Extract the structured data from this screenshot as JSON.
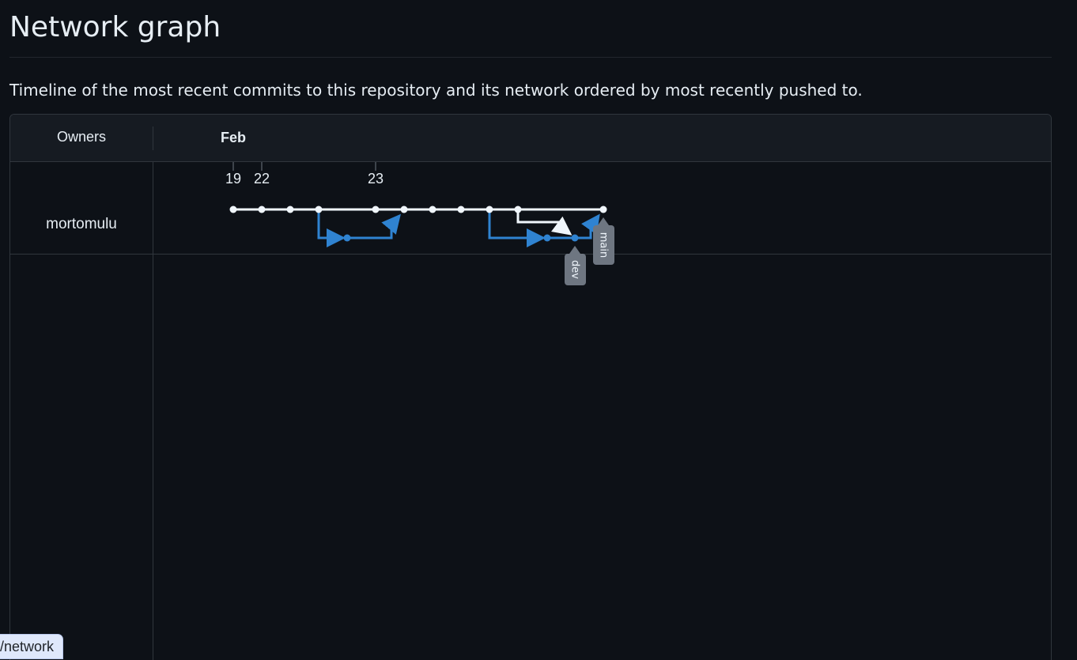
{
  "page": {
    "title": "Network graph",
    "description": "Timeline of the most recent commits to this repository and its network ordered by most recently pushed to."
  },
  "network": {
    "owners_label": "Owners",
    "month_label": "Feb",
    "owner_name": "mortomulu",
    "dates": [
      "19",
      "22",
      "23"
    ],
    "branch_labels": {
      "dev": "dev",
      "main": "main"
    },
    "colors": {
      "main_branch": "#f0f6fc",
      "dev_branch": "#2f83d1",
      "label_bg": "#6e7681",
      "grid": "#30363d",
      "background": "#0d1117",
      "header_bg": "#161b22"
    }
  },
  "status": {
    "text": "/network"
  }
}
